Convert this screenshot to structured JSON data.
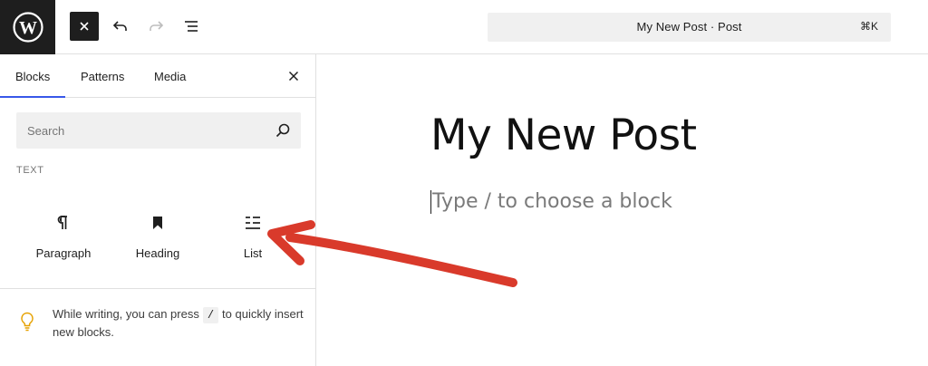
{
  "toolbar": {
    "logo_icon": "wordpress-logo",
    "close_icon": "close-icon",
    "undo_icon": "undo-icon",
    "redo_icon": "redo-icon",
    "document_overview_icon": "list-view-icon"
  },
  "command_bar": {
    "title": "My New Post · Post",
    "shortcut": "⌘K"
  },
  "inserter": {
    "tabs": [
      {
        "label": "Blocks",
        "active": true
      },
      {
        "label": "Patterns",
        "active": false
      },
      {
        "label": "Media",
        "active": false
      }
    ],
    "search_placeholder": "Search",
    "category": "TEXT",
    "blocks": [
      {
        "label": "Paragraph",
        "icon": "paragraph-icon"
      },
      {
        "label": "Heading",
        "icon": "bookmark-icon"
      },
      {
        "label": "List",
        "icon": "list-icon"
      }
    ],
    "tip": {
      "icon": "lightbulb-icon",
      "before": "While writing, you can press",
      "key": "/",
      "after": "to quickly insert new blocks."
    }
  },
  "editor": {
    "post_title": "My New Post",
    "block_placeholder": "Type / to choose a block"
  },
  "colors": {
    "accent": "#3858e9",
    "annotation_arrow": "#d93a2b",
    "toolbar_dark": "#1e1e1e"
  }
}
